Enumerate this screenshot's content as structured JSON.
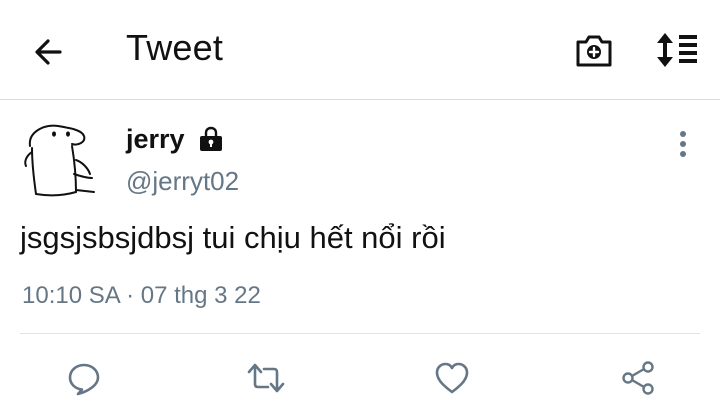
{
  "header": {
    "title": "Tweet",
    "icons": {
      "back": "arrow-left-icon",
      "camera": "camera-plus-icon",
      "sort": "sort-list-icon"
    }
  },
  "tweet": {
    "author": {
      "display_name": "jerry",
      "handle": "@jerryt02",
      "protected": true,
      "avatar_icon": "sketch-avatar"
    },
    "text": "jsgsjsbsjdbsj tui chịu hết nổi rồi",
    "timestamp": "10:10 SA · 07 thg 3 22",
    "actions": [
      "reply",
      "retweet",
      "like",
      "share"
    ]
  },
  "colors": {
    "text": "#111111",
    "secondary_text": "#657786",
    "icon": "#657786",
    "divider": "#e3e3e3"
  }
}
